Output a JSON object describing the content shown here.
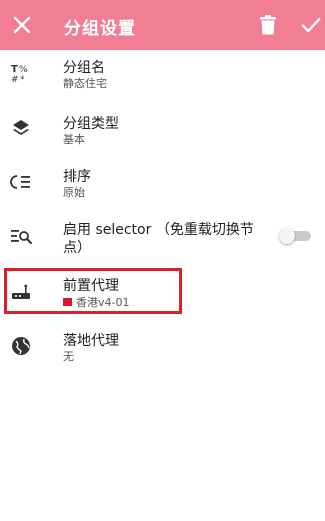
{
  "appbar": {
    "title": "分组设置",
    "close_icon": "close-icon",
    "delete_icon": "trash-icon",
    "confirm_icon": "check-icon",
    "background": "#f27e94"
  },
  "items": [
    {
      "label": "分组名",
      "value": "静态住宅",
      "icon": "text-format-icon"
    },
    {
      "label": "分组类型",
      "value": "基本",
      "icon": "layers-icon"
    },
    {
      "label": "排序",
      "value": "原始",
      "icon": "sort-icon"
    },
    {
      "label": "启用 selector （免重载切换节",
      "label_line2": "点）",
      "icon": "list-search-icon",
      "toggle": false
    },
    {
      "label": "前置代理",
      "value": "香港v4-01",
      "icon": "router-icon",
      "flag": "hong-kong-flag-icon"
    },
    {
      "label": "落地代理",
      "value": "无",
      "icon": "globe-icon"
    }
  ],
  "highlight_color": "#d9222a"
}
